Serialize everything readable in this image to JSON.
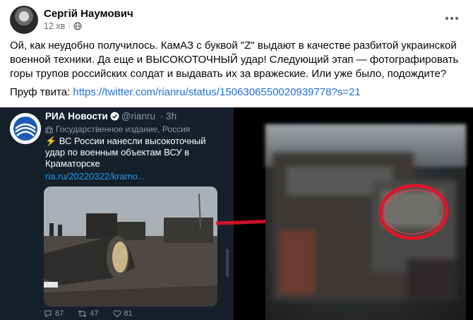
{
  "post": {
    "author": "Сергій Наумович",
    "time": "12 хв",
    "text": "Ой, как неудобно получилось. КамАЗ с буквой \"Z\" выдают в качестве разбитой украинской военной техники. Да еще и ВЫСОКОТОЧНЫЙ удар! Следующий этап — фотографировать горы трупов российских солдат и выдавать их за вражеские. Или уже было, подождите?",
    "proof_label": "Пруф твита: ",
    "proof_url": "https://twitter.com/rianru/status/1506306550020939778?s=21"
  },
  "tweet": {
    "name": "РИА Новости",
    "handle": "@rianru",
    "age": "· 3h",
    "state_label": "Государственное издание, Россия",
    "body": "⚡ ВС России нанесли высокоточный удар по военным объектам ВСУ в Краматорске",
    "link": "ria.ru/20220322/kramo...",
    "replies": "87",
    "retweets": "47",
    "likes": "81"
  },
  "icons": {
    "more": "more-horizontal-icon",
    "globe": "globe-icon",
    "verified": "verified-badge-icon",
    "reply": "reply-icon",
    "retweet": "retweet-icon",
    "like": "heart-icon",
    "arrow": "arrow-right-icon"
  },
  "colors": {
    "link": "#216fdb",
    "tweet_bg": "#15202b",
    "tweet_link": "#1d9bf0",
    "highlight": "#e0142a"
  }
}
